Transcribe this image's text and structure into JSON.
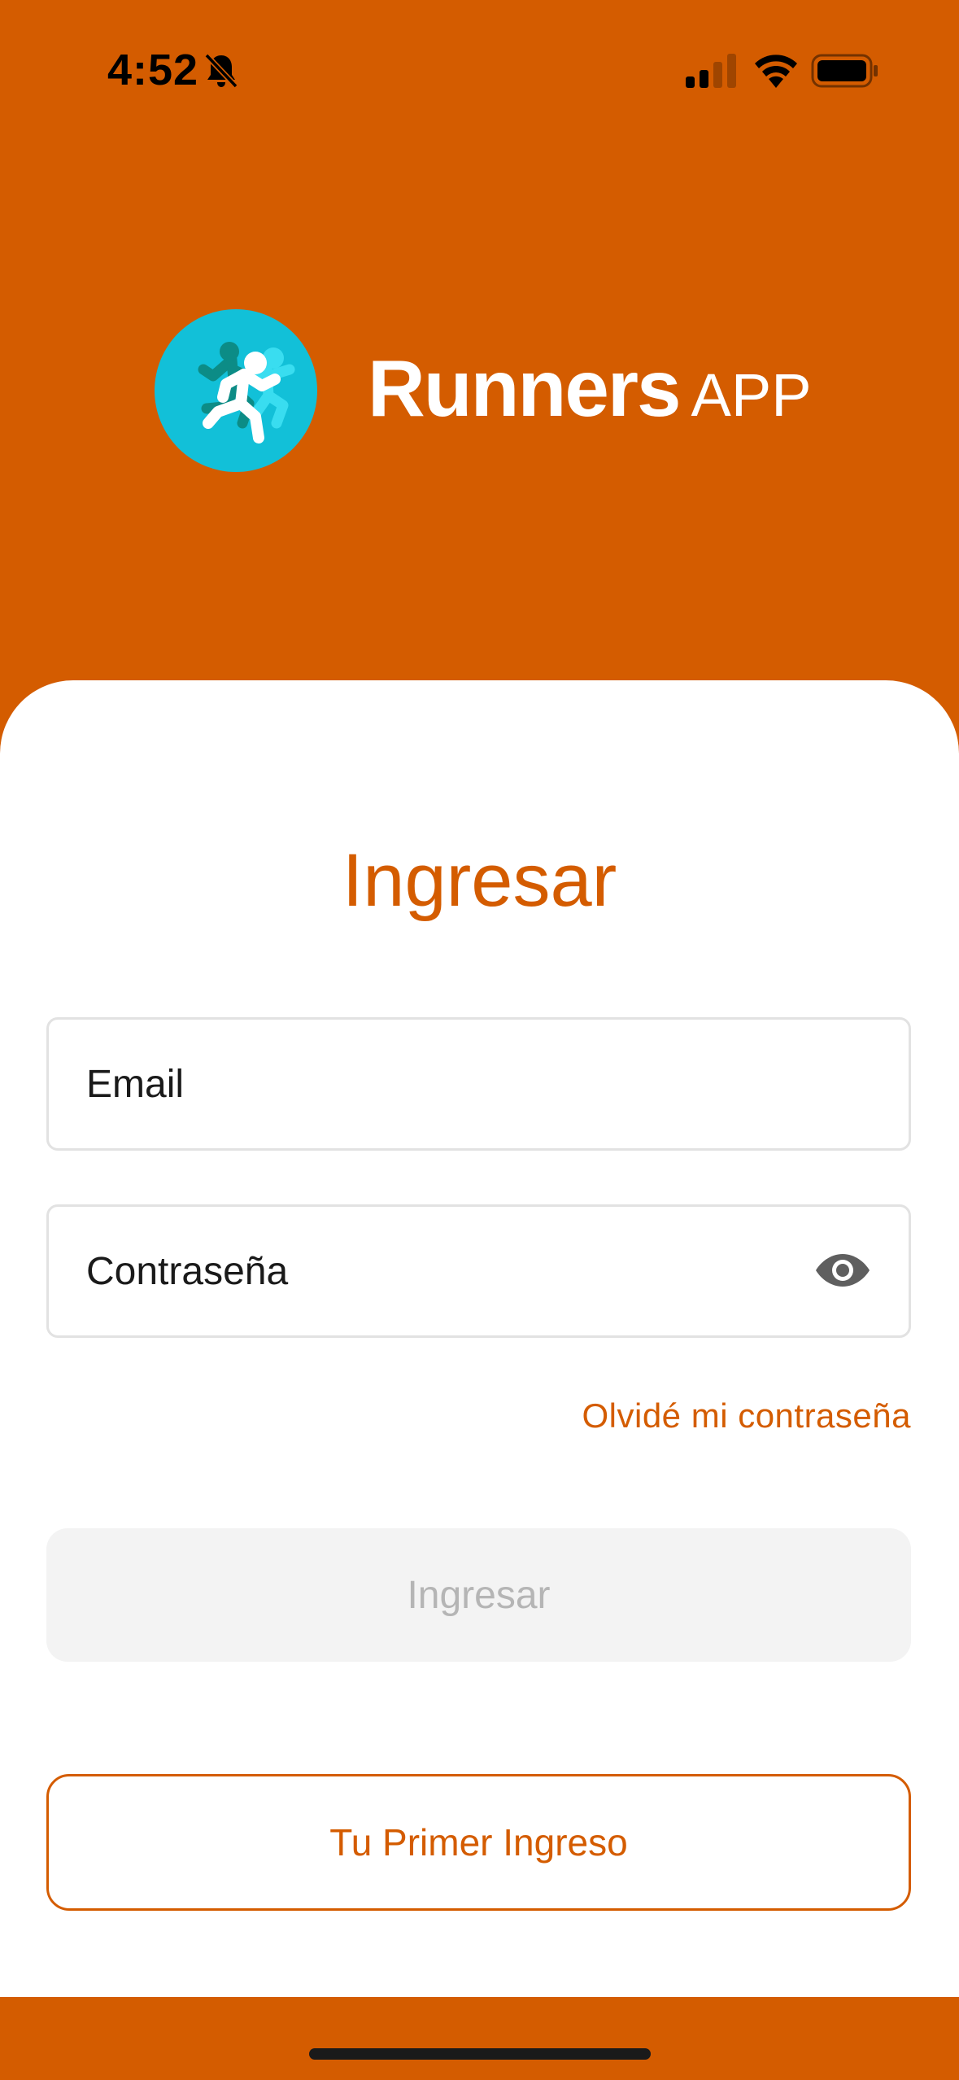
{
  "status_bar": {
    "time": "4:52",
    "icons": [
      "bell-off-icon",
      "signal-icon",
      "wifi-icon",
      "battery-icon"
    ]
  },
  "brand": {
    "name_main": "Runners",
    "name_sub": "APP",
    "logo_icon": "runners-logo-icon",
    "logo_color": "#12C0D8"
  },
  "login": {
    "title": "Ingresar",
    "email_placeholder": "Email",
    "password_placeholder": "Contraseña",
    "password_toggle_icon": "eye-icon",
    "forgot_password": "Olvidé mi contraseña",
    "submit_label": "Ingresar",
    "first_login_label": "Tu Primer Ingreso"
  },
  "colors": {
    "brand_orange": "#D45C00",
    "card_background": "#FFFFFF",
    "disabled_button": "#F3F3F3",
    "disabled_text": "#B5B5B5"
  }
}
